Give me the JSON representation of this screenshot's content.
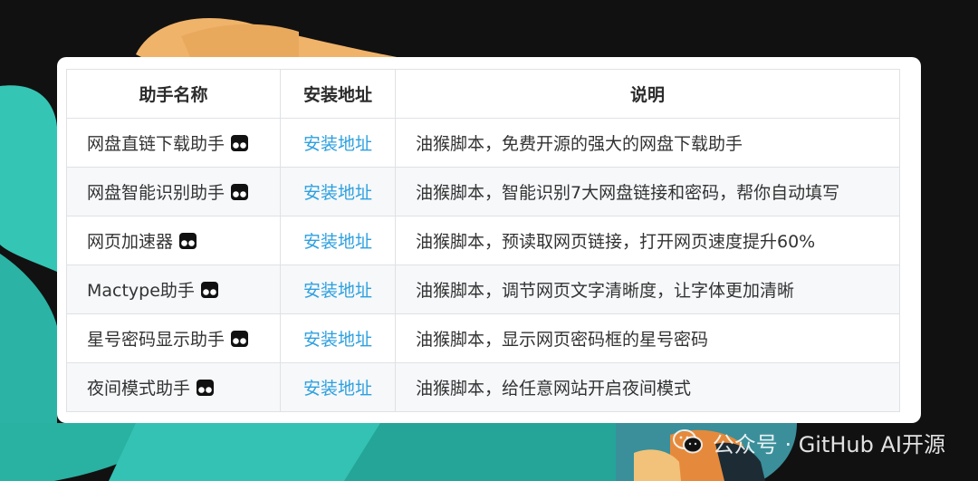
{
  "table": {
    "headers": [
      "助手名称",
      "安装地址",
      "说明"
    ],
    "rows": [
      {
        "name": "网盘直链下载助手",
        "link": "安装地址",
        "desc": "油猴脚本，免费开源的强大的网盘下载助手"
      },
      {
        "name": "网盘智能识别助手",
        "link": "安装地址",
        "desc": "油猴脚本，智能识别7大网盘链接和密码，帮你自动填写"
      },
      {
        "name": "网页加速器",
        "link": "安装地址",
        "desc": "油猴脚本，预读取网页链接，打开网页速度提升60%"
      },
      {
        "name": "Mactype助手",
        "link": "安装地址",
        "desc": "油猴脚本，调节网页文字清晰度，让字体更加清晰"
      },
      {
        "name": "星号密码显示助手",
        "link": "安装地址",
        "desc": "油猴脚本，显示网页密码框的星号密码"
      },
      {
        "name": "夜间模式助手",
        "link": "安装地址",
        "desc": "油猴脚本，给任意网站开启夜间模式"
      }
    ]
  },
  "footer": {
    "text": "公众号 · GitHub AI开源"
  },
  "icons": {
    "row_icon": "tampermonkey-icon",
    "footer_icon": "wechat-icon"
  },
  "colors": {
    "link": "#2da0df",
    "background": "#111111",
    "teal": "#2ec5b6",
    "orange": "#f2b066"
  }
}
